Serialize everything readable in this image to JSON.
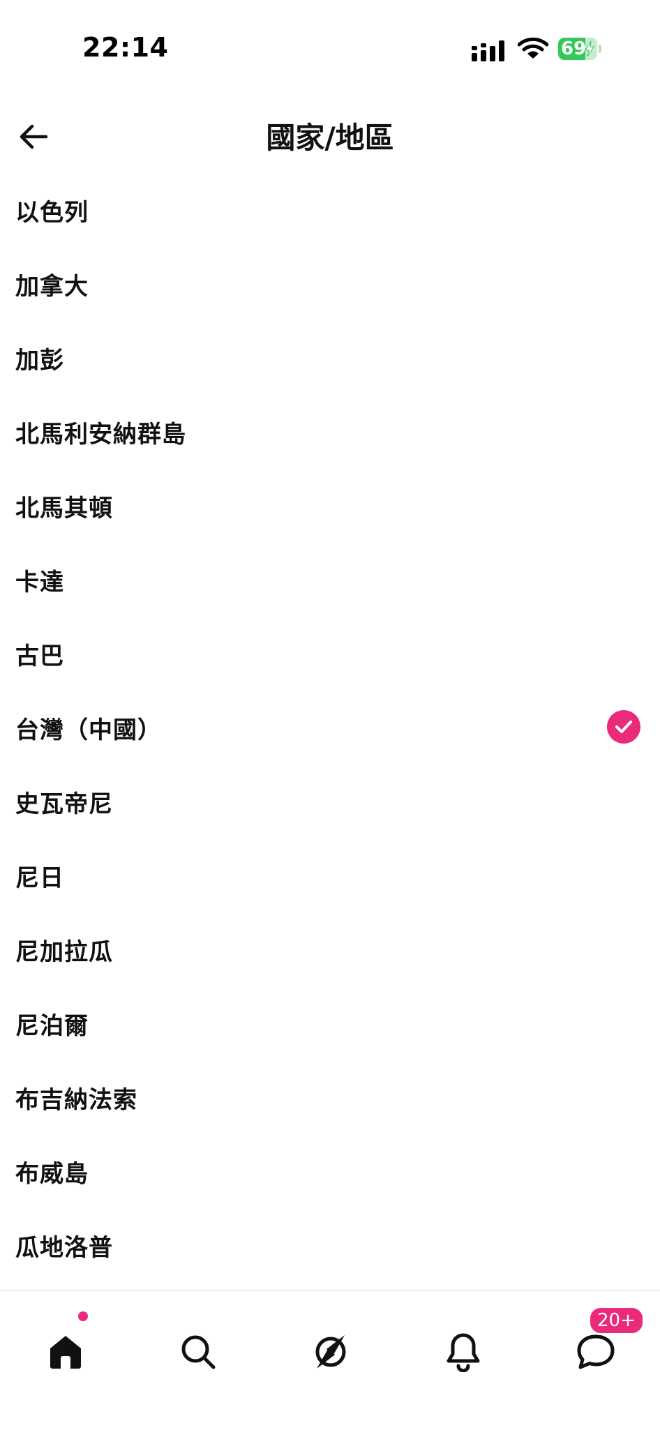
{
  "status_bar": {
    "time": "22:14",
    "battery_level": "69",
    "battery_charging": true,
    "icons": [
      "signal-icon",
      "wifi-icon",
      "battery-icon",
      "lightning-bolt-icon"
    ]
  },
  "header": {
    "title": "國家/地區",
    "back_icon": "arrow-left-icon"
  },
  "countries": [
    {
      "label": "以色列",
      "selected": false
    },
    {
      "label": "加拿大",
      "selected": false
    },
    {
      "label": "加彭",
      "selected": false
    },
    {
      "label": "北馬利安納群島",
      "selected": false
    },
    {
      "label": "北馬其頓",
      "selected": false
    },
    {
      "label": "卡達",
      "selected": false
    },
    {
      "label": "古巴",
      "selected": false
    },
    {
      "label": "台灣（中國）",
      "selected": true
    },
    {
      "label": "史瓦帝尼",
      "selected": false
    },
    {
      "label": "尼日",
      "selected": false
    },
    {
      "label": "尼加拉瓜",
      "selected": false
    },
    {
      "label": "尼泊爾",
      "selected": false
    },
    {
      "label": "布吉納法索",
      "selected": false
    },
    {
      "label": "布威島",
      "selected": false
    },
    {
      "label": "瓜地洛普",
      "selected": false
    }
  ],
  "selected_check_icon": "check-circle-icon",
  "bottom_nav": {
    "items": [
      {
        "icon": "home-icon",
        "active": true,
        "has_dot": true
      },
      {
        "icon": "search-icon",
        "active": false
      },
      {
        "icon": "explore-compass-icon",
        "active": false
      },
      {
        "icon": "bell-icon",
        "active": false
      },
      {
        "icon": "chat-bubble-icon",
        "active": false,
        "badge": "20+"
      }
    ]
  },
  "colors": {
    "accent": "#ea2a7b",
    "battery_green": "#34c759",
    "text": "#111111",
    "background": "#ffffff"
  }
}
